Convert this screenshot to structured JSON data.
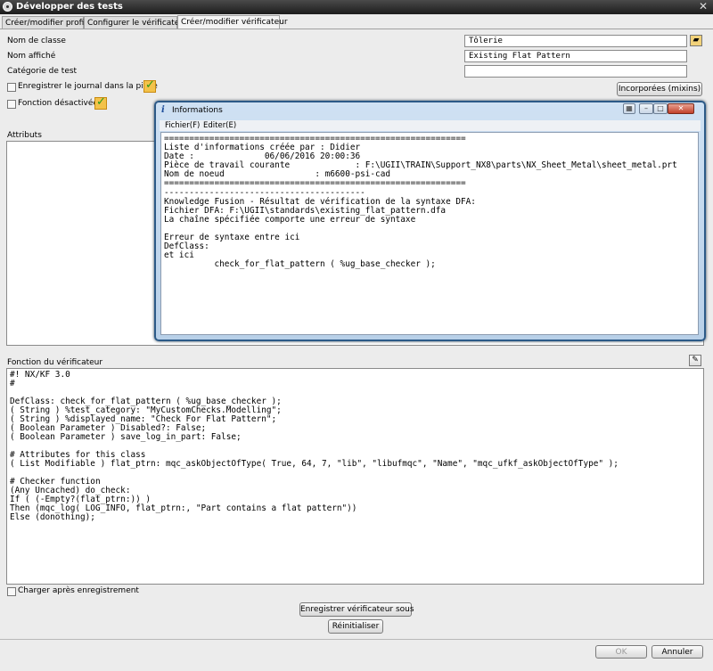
{
  "window": {
    "title": "Développer des tests"
  },
  "tabs": [
    {
      "label": "Créer/modifier profil"
    },
    {
      "label": "Configurer le vérificateur"
    },
    {
      "label": "Créer/modifier vérificateur"
    }
  ],
  "form": {
    "class_name_label": "Nom de classe",
    "class_name_value": "Tôlerie",
    "displayed_name_label": "Nom affiché",
    "displayed_name_value": "Existing Flat Pattern",
    "test_category_label": "Catégorie de test",
    "test_category_value": "",
    "log_in_part_label": "Enregistrer le journal dans la pièce",
    "disabled_function_label": "Fonction désactivée",
    "mixins_button": "Incorporées (mixins)"
  },
  "attributes": {
    "label": "Attributs"
  },
  "checker_function": {
    "label": "Fonction du vérificateur",
    "code": "#! NX/KF 3.0\n#\n\nDefClass: check_for_flat_pattern ( %ug_base_checker );\n( String ) %test_category: \"MyCustomChecks.Modelling\";\n( String ) %displayed_name: \"Check For Flat Pattern\";\n( Boolean Parameter ) Disabled?: False;\n( Boolean Parameter ) save_log_in_part: False;\n\n# Attributes for this class\n( List Modifiable ) flat_ptrn: mqc_askObjectOfType( True, 64, 7, \"lib\", \"libufmqc\", \"Name\", \"mqc_ufkf_askObjectOfType\" );\n\n# Checker function\n(Any Uncached) do_check:\nIf ( (-Empty?(flat_ptrn:)) )\nThen (mqc_log( LOG_INFO, flat_ptrn:, \"Part contains a flat pattern\"))\nElse (donothing);"
  },
  "footer": {
    "load_after_save_label": "Charger après enregistrement",
    "save_as_button": "Enregistrer vérificateur sous",
    "reset_button": "Réinitialiser",
    "ok_button": "OK",
    "cancel_button": "Annuler"
  },
  "info_window": {
    "title": "Informations",
    "menu": [
      {
        "label": "Fichier(F)"
      },
      {
        "label": "Editer(E)"
      }
    ],
    "content": "============================================================\nListe d'informations créée par : Didier\nDate :              06/06/2016 20:00:36\nPièce de travail courante             : F:\\UGII\\TRAIN\\Support_NX8\\parts\\NX_Sheet_Metal\\sheet_metal.prt\nNom de noeud                  : m6600-psi-cad\n============================================================\n----------------------------------------\nKnowledge Fusion - Résultat de vérification de la syntaxe DFA:\nFichier DFA: F:\\UGII\\standards\\existing_flat_pattern.dfa\nLa chaîne spécifiée comporte une erreur de syntaxe\n\nErreur de syntaxe entre ici\nDefClass:\net ici\n          check_for_flat_pattern ( %ug_base_checker );"
  }
}
